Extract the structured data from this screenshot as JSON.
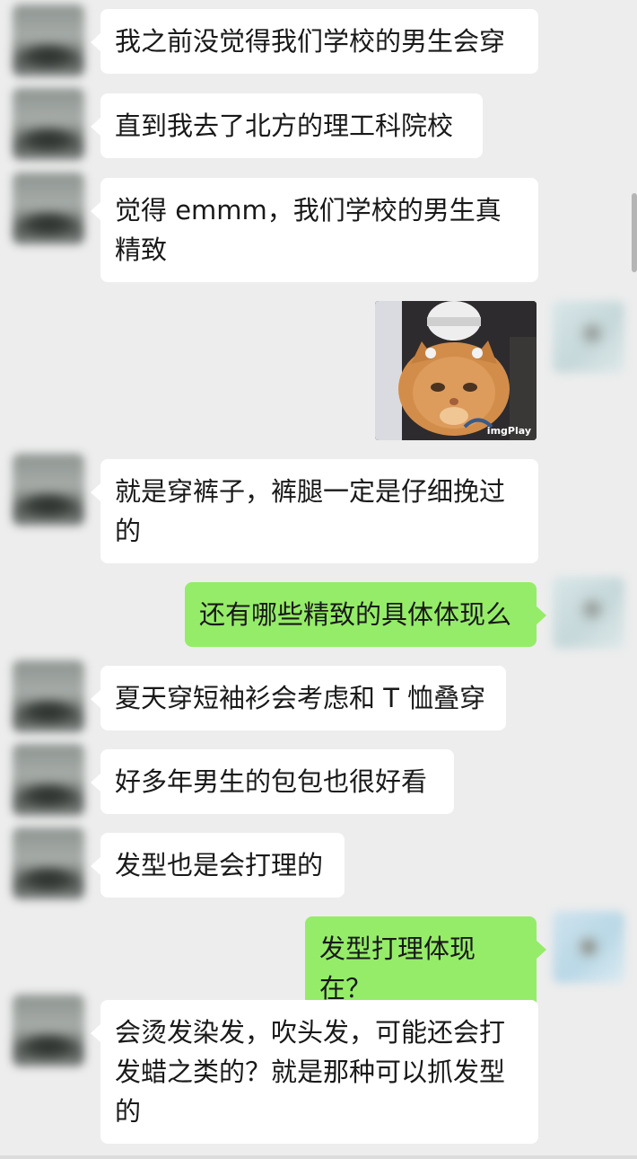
{
  "messages": [
    {
      "side": "in",
      "text": "我之前没觉得我们学校的男生会穿"
    },
    {
      "side": "in",
      "text": "直到我去了北方的理工科院校"
    },
    {
      "side": "in",
      "text": "觉得 emmm，我们学校的男生真精致"
    },
    {
      "side": "out",
      "type": "sticker",
      "sticker_caption": "imgPlay"
    },
    {
      "side": "in",
      "text": "就是穿裤子，裤腿一定是仔细挽过的"
    },
    {
      "side": "out",
      "text": "还有哪些精致的具体体现么"
    },
    {
      "side": "in",
      "text": "夏天穿短袖衫会考虑和 T 恤叠穿"
    },
    {
      "side": "in",
      "text": "好多年男生的包包也很好看"
    },
    {
      "side": "in",
      "text": "发型也是会打理的"
    },
    {
      "side": "out",
      "text": "发型打理体现在？"
    },
    {
      "side": "in",
      "text": "会烫发染发，吹头发，可能还会打发蜡之类的？就是那种可以抓发型的"
    }
  ],
  "colors": {
    "background": "#ededed",
    "incoming_bubble": "#ffffff",
    "outgoing_bubble": "#95ec69",
    "text": "#191919"
  }
}
